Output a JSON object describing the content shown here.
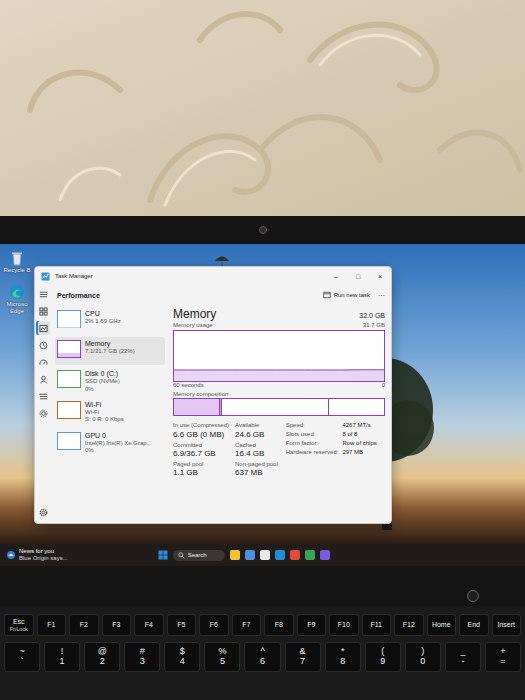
{
  "desktop": {
    "icons": [
      {
        "label": "Recycle B",
        "kind": "recycle"
      },
      {
        "label": "Microso Edge",
        "kind": "edge"
      }
    ]
  },
  "window": {
    "title": "Task Manager",
    "controls": [
      "–",
      "□",
      "×"
    ],
    "section": "Performance",
    "action": "Run new task",
    "more": "···"
  },
  "rail": {
    "items": [
      {
        "kind": "menu",
        "selected": false
      },
      {
        "kind": "processes",
        "selected": false
      },
      {
        "kind": "performance",
        "selected": true
      },
      {
        "kind": "history",
        "selected": false
      },
      {
        "kind": "startup",
        "selected": false
      },
      {
        "kind": "users",
        "selected": false
      },
      {
        "kind": "details",
        "selected": false
      },
      {
        "kind": "services",
        "selected": false
      }
    ],
    "bottom": {
      "kind": "settings",
      "selected": false
    }
  },
  "sidebar": {
    "items": [
      {
        "name": "CPU",
        "detail": "2% 1.69 GHz",
        "kind": "cpu",
        "level": 0.02,
        "selected": false
      },
      {
        "name": "Memory",
        "detail": "7.1/31.7 GB (22%)",
        "kind": "memory",
        "level": 0.22,
        "selected": true
      },
      {
        "name": "Disk 0 (C:)",
        "detail": "SSD (NVMe)",
        "extra": "0%",
        "kind": "disk",
        "level": 0.0,
        "selected": false
      },
      {
        "name": "Wi-Fi",
        "detail": "Wi-Fi",
        "extra": "S: 0 R: 0 Kbps",
        "kind": "network",
        "level": 0.0,
        "selected": false
      },
      {
        "name": "GPU 0",
        "detail": "Intel(R) Iris(R) Xe Grap...",
        "extra": "0%",
        "kind": "gpu",
        "level": 0.0,
        "selected": false
      }
    ]
  },
  "memory": {
    "title": "Memory",
    "total": "32.0 GB",
    "usage_label": "Memory usage",
    "usage_max": "31.7 GB",
    "time_label": "60 seconds",
    "zero": "0",
    "composition_label": "Memory composition",
    "max": 31.7,
    "usage": [
      7.0,
      7.0,
      7.0,
      7.0,
      7.0,
      7.0,
      7.0,
      7.0,
      7.0,
      7.0,
      7.0,
      7.0,
      7.0,
      7.0,
      7.0,
      7.0,
      7.0,
      7.0,
      7.0,
      7.0,
      7.0,
      7.0,
      7.0,
      7.0,
      7.0,
      7.1,
      7.1,
      7.1,
      7.1,
      7.1
    ],
    "composition": [
      {
        "kind": "in-use",
        "level": 0.22
      },
      {
        "kind": "modified",
        "level": 0.01
      },
      {
        "kind": "standby",
        "level": 0.51
      },
      {
        "kind": "free",
        "level": 0.26
      }
    ]
  },
  "stats": [
    {
      "label": "In use (Compressed)",
      "value": "6.6 GB (0 MB)"
    },
    {
      "label": "Available",
      "value": "24.6 GB"
    },
    {
      "label": "Committed",
      "value": "6.9/36.7 GB"
    },
    {
      "label": "Cached",
      "value": "16.4 GB"
    },
    {
      "label": "Paged pool",
      "value": "1.1 GB"
    },
    {
      "label": "Non-paged pool",
      "value": "637 MB"
    }
  ],
  "specs": [
    {
      "label": "Speed:",
      "value": "4267 MT/s"
    },
    {
      "label": "Slots used:",
      "value": "8 of 8"
    },
    {
      "label": "Form factor:",
      "value": "Row of chips"
    },
    {
      "label": "Hardware reserved:",
      "value": "297 MB"
    }
  ],
  "taskbar": {
    "news_title": "News for you",
    "news_text": "Blue Origin says...",
    "search": "Search"
  },
  "keyboard": {
    "function_row": [
      {
        "label": "Esc",
        "sub": "FnLock"
      },
      {
        "label": "F1"
      },
      {
        "label": "F2"
      },
      {
        "label": "F3"
      },
      {
        "label": "F4"
      },
      {
        "label": "F5"
      },
      {
        "label": "F6"
      },
      {
        "label": "F7"
      },
      {
        "label": "F8"
      },
      {
        "label": "F9"
      },
      {
        "label": "F10"
      },
      {
        "label": "F11"
      },
      {
        "label": "F12"
      },
      {
        "label": "Home"
      },
      {
        "label": "End"
      },
      {
        "label": "Insert"
      }
    ],
    "number_row": [
      {
        "top": "~",
        "bottom": "`"
      },
      {
        "top": "!",
        "bottom": "1"
      },
      {
        "top": "@",
        "bottom": "2"
      },
      {
        "top": "#",
        "bottom": "3"
      },
      {
        "top": "$",
        "bottom": "4"
      },
      {
        "top": "%",
        "bottom": "5"
      },
      {
        "top": "^",
        "bottom": "6"
      },
      {
        "top": "&",
        "bottom": "7"
      },
      {
        "top": "*",
        "bottom": "8"
      },
      {
        "top": "(",
        "bottom": "9"
      },
      {
        "top": ")",
        "bottom": "0"
      },
      {
        "top": "_",
        "bottom": "-"
      },
      {
        "top": "+",
        "bottom": "="
      }
    ]
  }
}
